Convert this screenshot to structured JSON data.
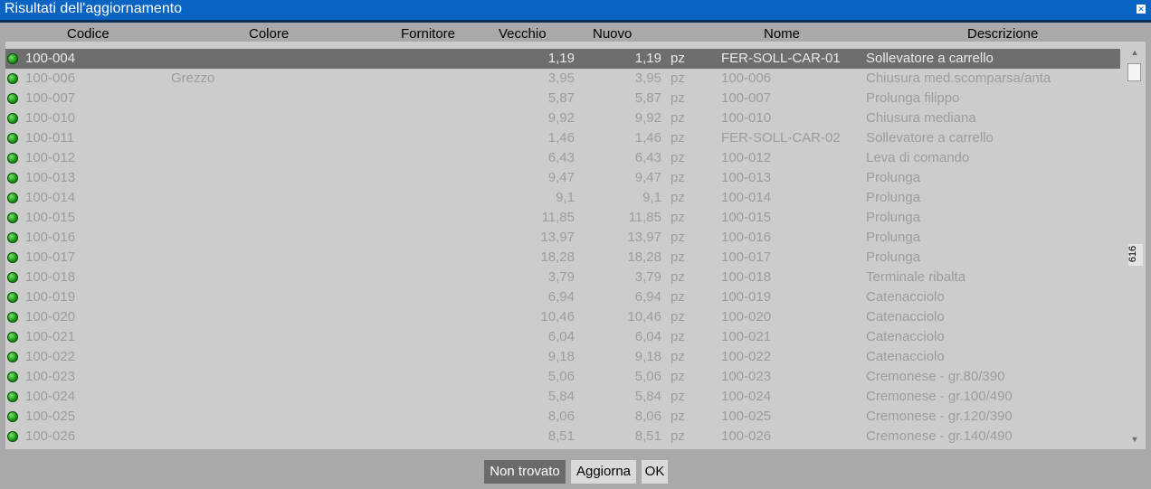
{
  "window": {
    "title": "Risultati dell'aggiornamento",
    "close_icon": "close-icon"
  },
  "columns": {
    "codice": "Codice",
    "colore": "Colore",
    "fornitore": "Fornitore",
    "vecchio": "Vecchio",
    "nuovo": "Nuovo",
    "nome": "Nome",
    "descrizione": "Descrizione"
  },
  "rows": [
    {
      "codice": "100-004",
      "colore": "",
      "vecchio": "1,19",
      "nuovo": "1,19",
      "unit": "pz",
      "nome": "FER-SOLL-CAR-01",
      "descrizione": "Sollevatore a carrello",
      "status": "green"
    },
    {
      "codice": "100-006",
      "colore": "Grezzo",
      "vecchio": "3,95",
      "nuovo": "3,95",
      "unit": "pz",
      "nome": "100-006",
      "descrizione": "Chiusura med.scomparsa/anta",
      "status": "green"
    },
    {
      "codice": "100-007",
      "colore": "",
      "vecchio": "5,87",
      "nuovo": "5,87",
      "unit": "pz",
      "nome": "100-007",
      "descrizione": "Prolunga filippo",
      "status": "green"
    },
    {
      "codice": "100-010",
      "colore": "",
      "vecchio": "9,92",
      "nuovo": "9,92",
      "unit": "pz",
      "nome": "100-010",
      "descrizione": "Chiusura mediana",
      "status": "green"
    },
    {
      "codice": "100-011",
      "colore": "",
      "vecchio": "1,46",
      "nuovo": "1,46",
      "unit": "pz",
      "nome": "FER-SOLL-CAR-02",
      "descrizione": "Sollevatore a carrello",
      "status": "green"
    },
    {
      "codice": "100-012",
      "colore": "",
      "vecchio": "6,43",
      "nuovo": "6,43",
      "unit": "pz",
      "nome": "100-012",
      "descrizione": "Leva di comando",
      "status": "green"
    },
    {
      "codice": "100-013",
      "colore": "",
      "vecchio": "9,47",
      "nuovo": "9,47",
      "unit": "pz",
      "nome": "100-013",
      "descrizione": "Prolunga",
      "status": "green"
    },
    {
      "codice": "100-014",
      "colore": "",
      "vecchio": "9,1",
      "nuovo": "9,1",
      "unit": "pz",
      "nome": "100-014",
      "descrizione": "Prolunga",
      "status": "green"
    },
    {
      "codice": "100-015",
      "colore": "",
      "vecchio": "11,85",
      "nuovo": "11,85",
      "unit": "pz",
      "nome": "100-015",
      "descrizione": "Prolunga",
      "status": "green"
    },
    {
      "codice": "100-016",
      "colore": "",
      "vecchio": "13,97",
      "nuovo": "13,97",
      "unit": "pz",
      "nome": "100-016",
      "descrizione": "Prolunga",
      "status": "green"
    },
    {
      "codice": "100-017",
      "colore": "",
      "vecchio": "18,28",
      "nuovo": "18,28",
      "unit": "pz",
      "nome": "100-017",
      "descrizione": "Prolunga",
      "status": "green"
    },
    {
      "codice": "100-018",
      "colore": "",
      "vecchio": "3,79",
      "nuovo": "3,79",
      "unit": "pz",
      "nome": "100-018",
      "descrizione": "Terminale ribalta",
      "status": "green"
    },
    {
      "codice": "100-019",
      "colore": "",
      "vecchio": "6,94",
      "nuovo": "6,94",
      "unit": "pz",
      "nome": "100-019",
      "descrizione": "Catenacciolo",
      "status": "green"
    },
    {
      "codice": "100-020",
      "colore": "",
      "vecchio": "10,46",
      "nuovo": "10,46",
      "unit": "pz",
      "nome": "100-020",
      "descrizione": "Catenacciolo",
      "status": "green"
    },
    {
      "codice": "100-021",
      "colore": "",
      "vecchio": "6,04",
      "nuovo": "6,04",
      "unit": "pz",
      "nome": "100-021",
      "descrizione": "Catenacciolo",
      "status": "green"
    },
    {
      "codice": "100-022",
      "colore": "",
      "vecchio": "9,18",
      "nuovo": "9,18",
      "unit": "pz",
      "nome": "100-022",
      "descrizione": "Catenacciolo",
      "status": "green"
    },
    {
      "codice": "100-023",
      "colore": "",
      "vecchio": "5,06",
      "nuovo": "5,06",
      "unit": "pz",
      "nome": "100-023",
      "descrizione": "Cremonese - gr.80/390",
      "status": "green"
    },
    {
      "codice": "100-024",
      "colore": "",
      "vecchio": "5,84",
      "nuovo": "5,84",
      "unit": "pz",
      "nome": "100-024",
      "descrizione": "Cremonese - gr.100/490",
      "status": "green"
    },
    {
      "codice": "100-025",
      "colore": "",
      "vecchio": "8,06",
      "nuovo": "8,06",
      "unit": "pz",
      "nome": "100-025",
      "descrizione": "Cremonese - gr.120/390",
      "status": "green"
    },
    {
      "codice": "100-026",
      "colore": "",
      "vecchio": "8,51",
      "nuovo": "8,51",
      "unit": "pz",
      "nome": "100-026",
      "descrizione": "Cremonese - gr.140/490",
      "status": "green"
    }
  ],
  "selected_row_index": 0,
  "scroll": {
    "count": "616",
    "up_icon": "chevron-up-icon",
    "down_icon": "chevron-down-icon"
  },
  "buttons": {
    "not_found": "Non trovato",
    "update": "Aggiorna",
    "ok": "OK"
  },
  "colors": {
    "titlebar": "#0a64c4",
    "status_ok": "#1f9a17",
    "selected_row": "#6e6e6e"
  }
}
